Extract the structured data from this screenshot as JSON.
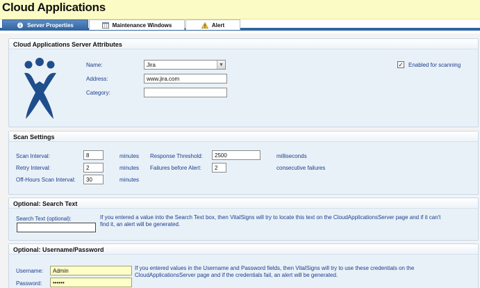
{
  "app": {
    "title": "Cloud Applications"
  },
  "tabs": [
    {
      "label": "Server Properties",
      "icon": "info-icon",
      "active": true
    },
    {
      "label": "Maintenance Windows",
      "icon": "calendar-icon",
      "active": false
    },
    {
      "label": "Alert",
      "icon": "warning-icon",
      "active": false
    }
  ],
  "attributes": {
    "heading": "Cloud Applications Server Attributes",
    "name_label": "Name:",
    "name_value": "Jira",
    "address_label": "Address:",
    "address_value": "www.jira.com",
    "category_label": "Category:",
    "category_value": "",
    "enabled_label": "Enabled for scanning",
    "enabled_checked": true,
    "logo_icon": "jira-logo-icon"
  },
  "scan": {
    "heading": "Scan Settings",
    "interval_label": "Scan Interval:",
    "interval_value": "8",
    "interval_unit": "minutes",
    "retry_label": "Retry Interval:",
    "retry_value": "2",
    "retry_unit": "minutes",
    "offhours_label": "Off-Hours Scan Interval:",
    "offhours_value": "30",
    "offhours_unit": "minutes",
    "response_label": "Response Threshold:",
    "response_value": "2500",
    "response_unit": "milliseconds",
    "failures_label": "Failures before Alert:",
    "failures_value": "2",
    "failures_unit": "consecutive failures"
  },
  "search": {
    "heading": "Optional: Search Text",
    "label": "Search Text (optional):",
    "value": "",
    "help_line1": "If you entered a value into the Search Text box, then VitalSigns will try to locate this text on the CloudApplicationsServer page and if it can't",
    "help_line2": "find it, an alert will be generated."
  },
  "credentials": {
    "heading": "Optional: Username/Password",
    "username_label": "Username:",
    "username_value": "Admin",
    "password_label": "Password:",
    "password_value": "••••••",
    "help_line1": "If you entered values in the Username and Password fields, then VitalSigns will try to use these credentials on the",
    "help_line2": "CloudApplicationsServer page and if the credentials fail, an alert will be generated."
  },
  "colors": {
    "accent": "#2f65a3",
    "title_bg": "#fbfbc6",
    "label_text": "#1a3c8c",
    "logo": "#1f4e8c"
  }
}
